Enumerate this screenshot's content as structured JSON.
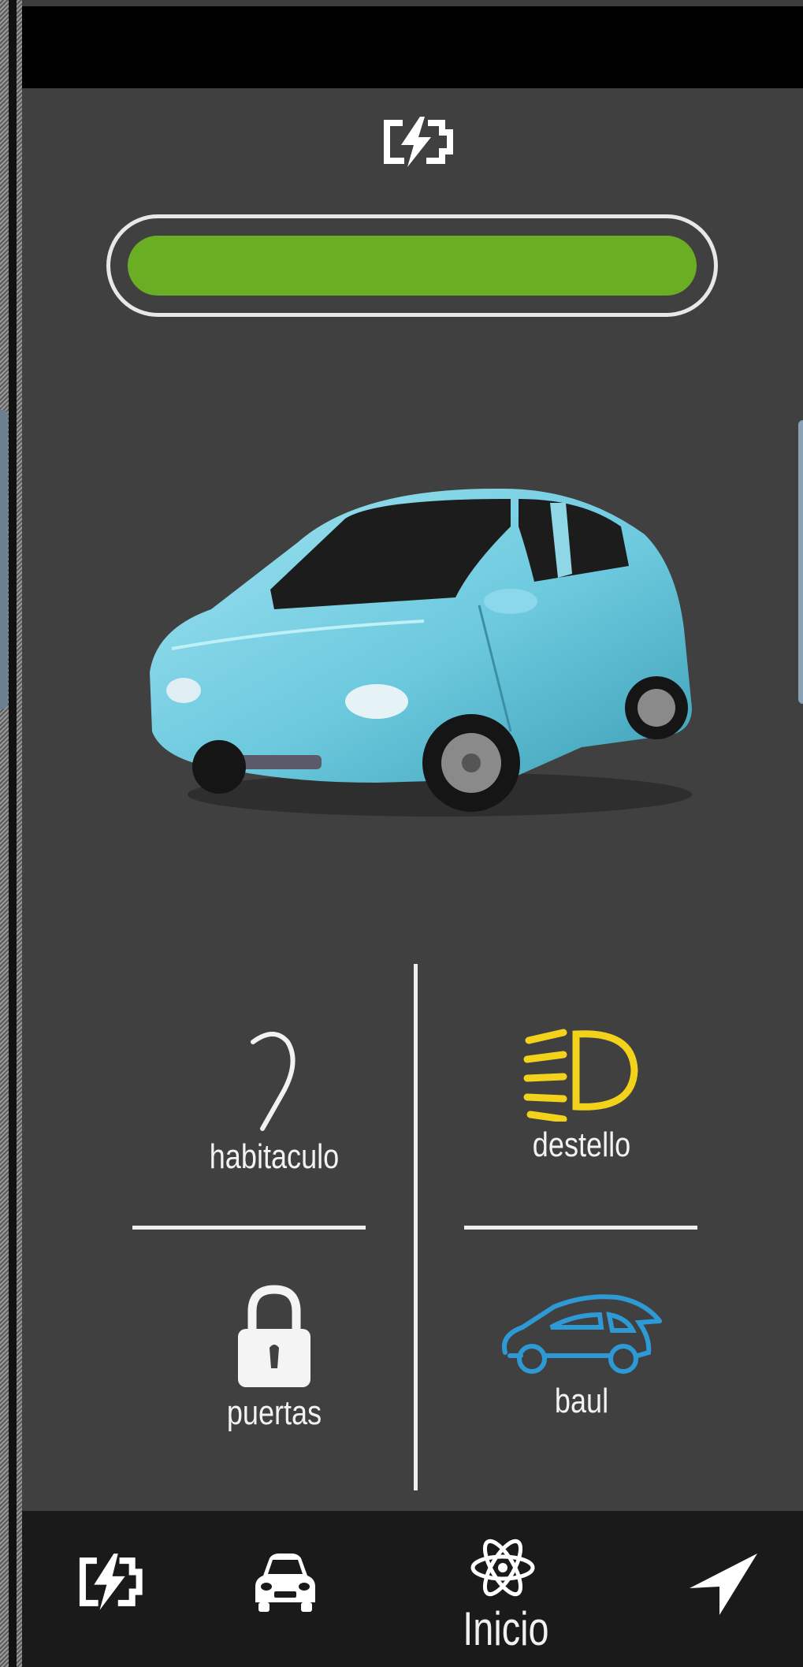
{
  "battery": {
    "icon": "battery-charging-icon",
    "level_percent": 100,
    "fill_color": "#6aae24"
  },
  "vehicle": {
    "image": "electric-car-image",
    "color": "#7fd3e6"
  },
  "controls": {
    "cabin": {
      "label": "habitaculo",
      "icon": "fan-icon"
    },
    "flash": {
      "label": "destello",
      "icon": "headlight-icon",
      "color": "#f2d21b"
    },
    "doors": {
      "label": "puertas",
      "icon": "padlock-icon"
    },
    "trunk": {
      "label": "baul",
      "icon": "car-outline-icon",
      "color": "#2d9ad6"
    }
  },
  "nav": {
    "items": [
      {
        "icon": "battery-charging-icon"
      },
      {
        "icon": "car-front-icon"
      },
      {
        "icon": "atom-icon",
        "label": "Inicio"
      },
      {
        "icon": "navigation-arrow-icon"
      }
    ]
  }
}
